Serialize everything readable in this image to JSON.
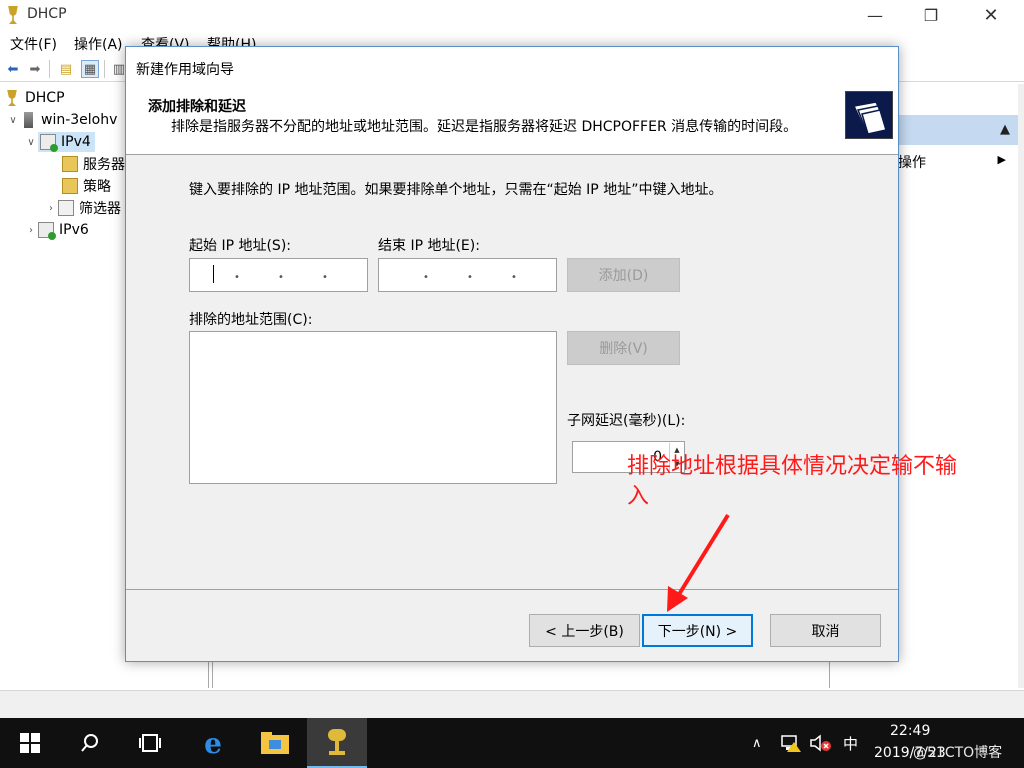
{
  "window": {
    "title": "DHCP",
    "menu": [
      "文件(F)",
      "操作(A)",
      "查看(V)",
      "帮助(H)"
    ]
  },
  "tree": {
    "root": "DHCP",
    "server": "win-3elohv",
    "ipv4": "IPv4",
    "children": [
      "服务器",
      "策略",
      "筛选器"
    ],
    "ipv6": "IPv6"
  },
  "actions_pane": {
    "more_actions": "操作"
  },
  "wizard": {
    "title": "新建作用域向导",
    "heading": "添加排除和延迟",
    "description": "排除是指服务器不分配的地址或地址范围。延迟是指服务器将延迟 DHCPOFFER 消息传输的时间段。",
    "instruction": "键入要排除的 IP 地址范围。如果要排除单个地址，只需在“起始 IP 地址”中键入地址。",
    "start_ip_label": "起始 IP 地址(S):",
    "end_ip_label": "结束 IP 地址(E):",
    "add_button": "添加(D)",
    "excluded_label": "排除的地址范围(C):",
    "remove_button": "删除(V)",
    "delay_label": "子网延迟(毫秒)(L):",
    "delay_value": "0",
    "back_button": "< 上一步(B)",
    "next_button": "下一步(N) >",
    "cancel_button": "取消"
  },
  "annotation": {
    "text": "排除地址根据具体情况决定输不输入",
    "color": "#ff1a1a"
  },
  "taskbar": {
    "ime": "中",
    "time": "22:49",
    "date": "2019/7/23",
    "watermark": "@51CTO博客"
  },
  "icons": [
    "dhcp-icon",
    "windows-start-icon",
    "search-icon",
    "task-view-icon",
    "internet-explorer-icon",
    "file-explorer-icon",
    "dhcp-taskbar-icon",
    "chevron-up-icon",
    "network-warning-icon",
    "volume-muted-icon"
  ],
  "colors": {
    "accent": "#0078d7",
    "taskbar": "#101010",
    "selection": "#cce4f7",
    "actions_header": "#c5daf0"
  }
}
